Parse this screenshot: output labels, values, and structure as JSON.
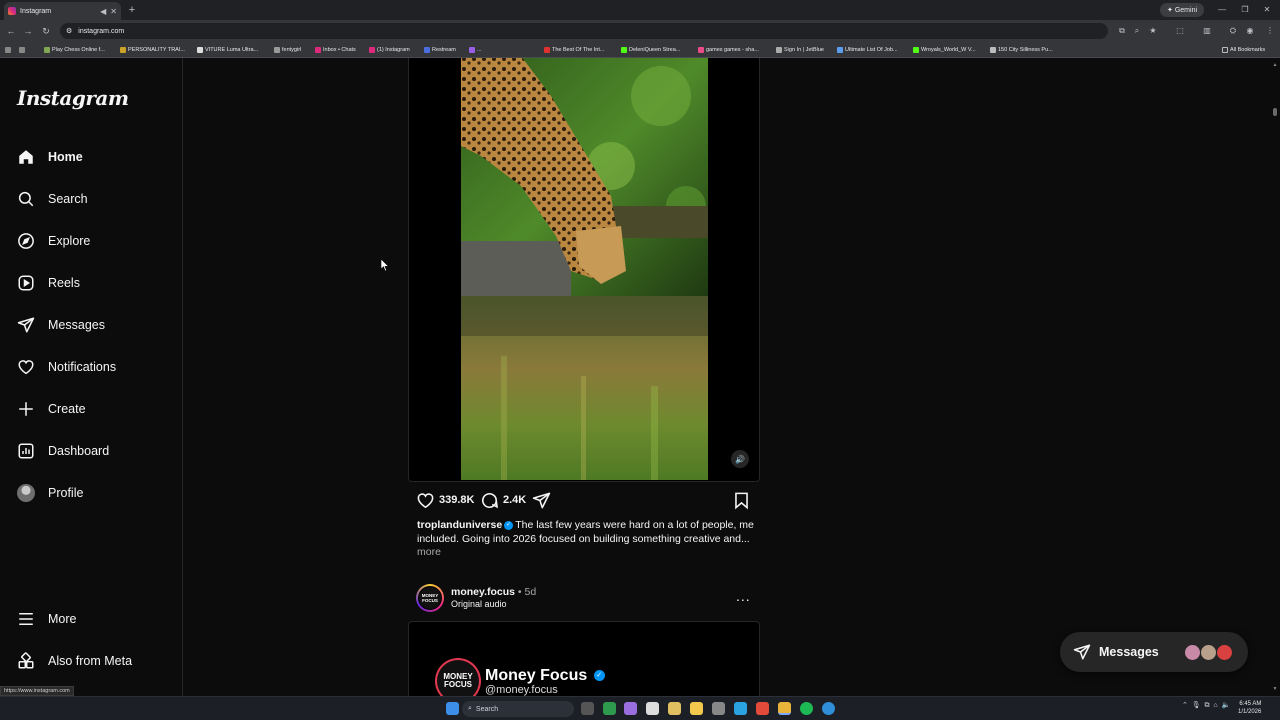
{
  "browser": {
    "tab_title": "Instagram",
    "new_tab": "+",
    "gemini_label": "Gemini",
    "url": "instagram.com",
    "bookmarks": [
      "Play Chess Online f...",
      "PERSONALITY TRAI...",
      "VITURE Luma Ultra...",
      "fentygirl",
      "Inbox • Chats",
      "(1) Instagram",
      "Restream",
      "...",
      "The Best Of The Int...",
      "DeleniQueen Strea...",
      "games games - sha...",
      "Sign In | JetBlue",
      "Ultimate List Of Job...",
      "Wroyals_World_W V...",
      "150 City Silliness Pu..."
    ],
    "all_bookmarks": "All Bookmarks",
    "status_url": "https://www.instagram.com"
  },
  "colors": {
    "bg": "#0c0c0c",
    "verified": "#0095f6",
    "secondary_text": "#a8a8a8"
  },
  "sidebar": {
    "logo": "Instagram",
    "items": [
      {
        "label": "Home",
        "icon": "home-icon"
      },
      {
        "label": "Search",
        "icon": "search-icon"
      },
      {
        "label": "Explore",
        "icon": "compass-icon"
      },
      {
        "label": "Reels",
        "icon": "reels-icon"
      },
      {
        "label": "Messages",
        "icon": "send-icon"
      },
      {
        "label": "Notifications",
        "icon": "heart-icon"
      },
      {
        "label": "Create",
        "icon": "plus-icon"
      },
      {
        "label": "Dashboard",
        "icon": "dashboard-icon"
      },
      {
        "label": "Profile",
        "icon": "avatar"
      }
    ],
    "more": "More",
    "also_from_meta": "Also from Meta"
  },
  "post1": {
    "likes": "339.8K",
    "comments": "2.4K",
    "username": "troplanduniverse",
    "caption": "The last few years were hard on a lot of people, me included. Going into 2026 focused on building something creative and...",
    "more": "more"
  },
  "post2": {
    "username": "money.focus",
    "time": "5d",
    "separator": "•",
    "audio": "Original audio",
    "avatar_text": "MONEY FOCUS",
    "media_name": "Money Focus",
    "media_handle": "@money.focus",
    "menu": "..."
  },
  "messages_pill": {
    "label": "Messages"
  },
  "taskbar": {
    "search_label": "Search",
    "time": "6:45 AM",
    "date": "1/1/2026"
  }
}
